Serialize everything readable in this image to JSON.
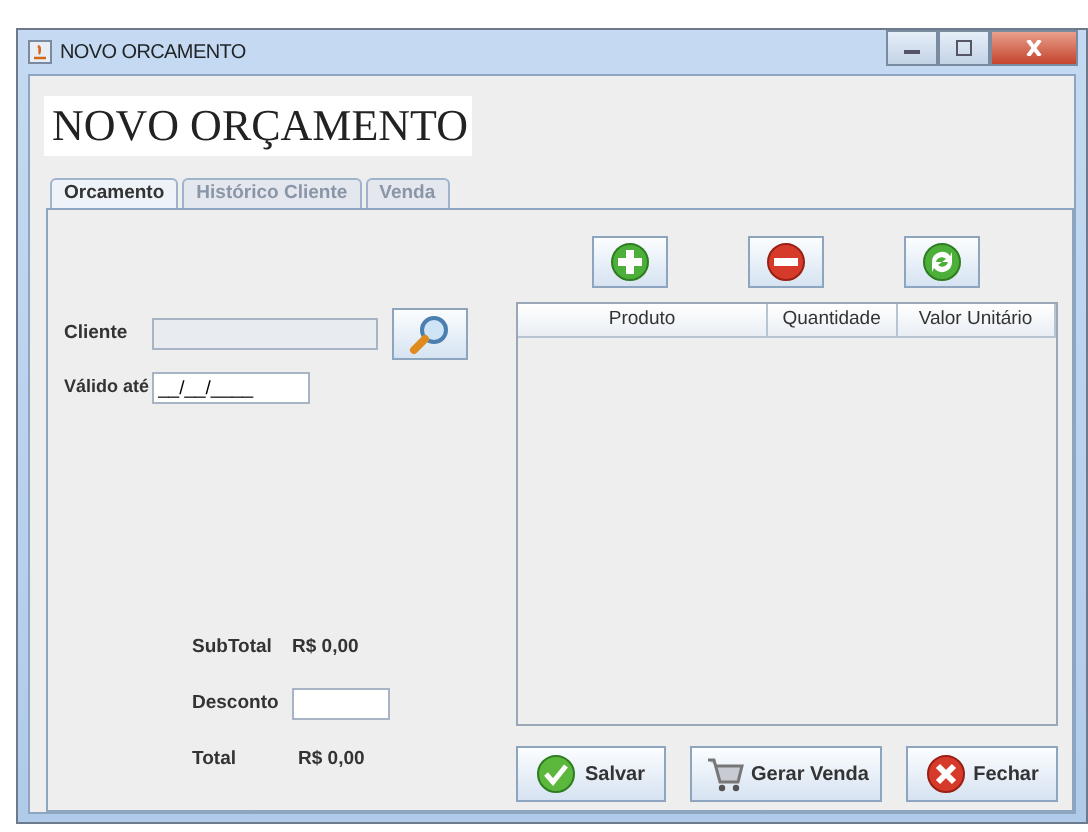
{
  "window": {
    "title": "NOVO ORCAMENTO"
  },
  "heading": "NOVO ORÇAMENTO",
  "tabs": [
    {
      "label": "Orcamento",
      "selected": true
    },
    {
      "label": "Histórico Cliente",
      "selected": false
    },
    {
      "label": "Venda",
      "selected": false
    }
  ],
  "client": {
    "label": "Cliente",
    "disabled": true
  },
  "valid_until": {
    "label": "Válido até",
    "value": "__/__/____"
  },
  "subtotal": {
    "label": "SubTotal",
    "value": "R$ 0,00"
  },
  "discount": {
    "label": "Desconto"
  },
  "total": {
    "label": "Total",
    "value": "R$ 0,00"
  },
  "item_buttons": [
    {
      "kind": "add"
    },
    {
      "kind": "remove"
    },
    {
      "kind": "refresh"
    }
  ],
  "table": {
    "columns": [
      "Produto",
      "Quantidade",
      "Valor Unitário"
    ]
  },
  "actions": [
    {
      "kind": "save",
      "label": "Salvar"
    },
    {
      "kind": "sale",
      "label": "Gerar Venda"
    },
    {
      "kind": "close",
      "label": "Fechar"
    }
  ]
}
